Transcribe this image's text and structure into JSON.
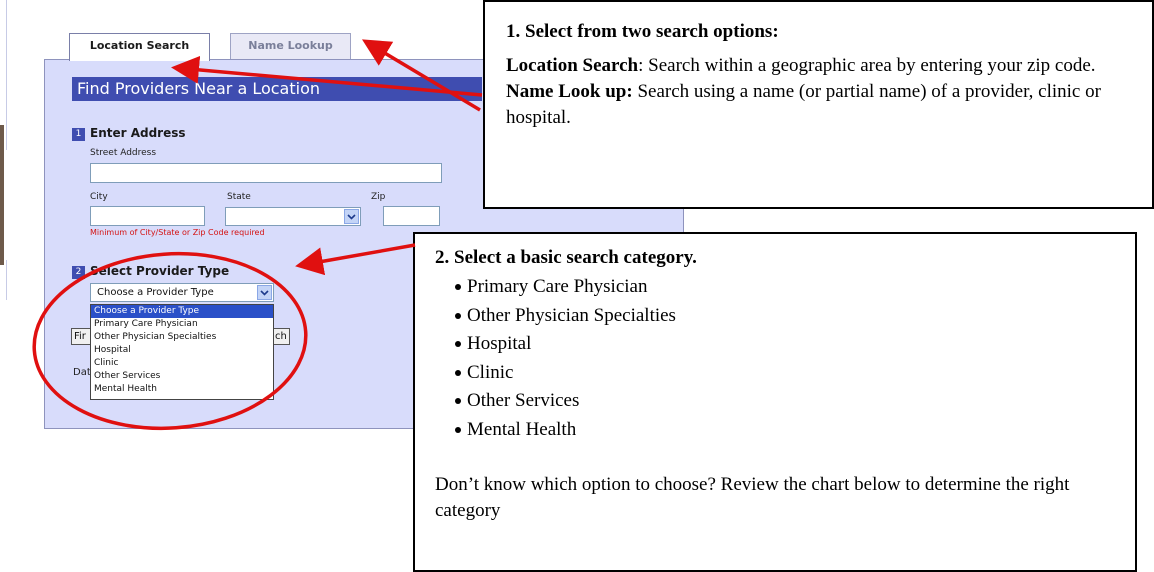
{
  "tabs": [
    {
      "label": "Location Search",
      "active": true
    },
    {
      "label": "Name Lookup",
      "active": false
    }
  ],
  "panel": {
    "title": "Find Providers Near a Location",
    "step1": {
      "number": "1",
      "label": "Enter Address"
    },
    "fields": {
      "street_label": "Street Address",
      "street_value": "",
      "city_label": "City",
      "city_value": "",
      "state_label": "State",
      "state_value": "",
      "zip_label": "Zip",
      "zip_value": ""
    },
    "required_note": "Minimum of City/State or Zip Code required",
    "step2": {
      "number": "2",
      "label": "Select Provider Type"
    },
    "provider_select": {
      "selected": "Choose a Provider Type",
      "options": [
        "Choose a Provider Type",
        "Primary Care Physician",
        "Other Physician Specialties",
        "Hospital",
        "Clinic",
        "Other Services",
        "Mental Health"
      ]
    },
    "partial_button_left": "Fir",
    "partial_button_right": "ch",
    "partial_text": "Dat"
  },
  "callout1": {
    "heading": "1.  Select from two search options:",
    "location_term": "Location Search",
    "location_desc": ":  Search within a geographic area by entering your zip code.",
    "name_term": "Name Look up:",
    "name_desc": "  Search using a name (or partial name) of a provider, clinic or hospital."
  },
  "callout2": {
    "heading": "2.  Select a basic search category.",
    "items": [
      "Primary Care Physician",
      "Other Physician Specialties",
      "Hospital",
      "Clinic",
      "Other Services",
      "Mental Health"
    ],
    "footer": "Don’t know which option to choose?  Review the chart below to determine the right category"
  },
  "colors": {
    "panel_bg": "#d8dcfb",
    "title_bar": "#3f4db0",
    "annotation_red": "#e01010",
    "required_text": "#d41212",
    "selected_option": "#2a50c8"
  }
}
